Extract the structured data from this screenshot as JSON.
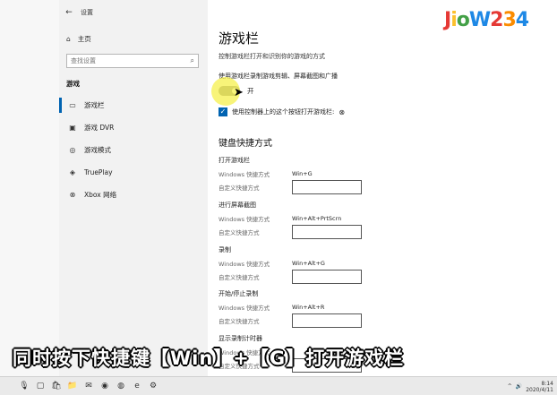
{
  "window": {
    "title": "设置",
    "back_icon": "back-arrow-icon"
  },
  "sidebar": {
    "home_label": "主页",
    "search_placeholder": "查找设置",
    "category": "游戏",
    "items": [
      {
        "label": "游戏栏",
        "icon": "game-bar-icon",
        "active": true
      },
      {
        "label": "游戏 DVR",
        "icon": "dvr-icon",
        "active": false
      },
      {
        "label": "游戏模式",
        "icon": "game-mode-icon",
        "active": false
      },
      {
        "label": "TruePlay",
        "icon": "trueplay-icon",
        "active": false
      },
      {
        "label": "Xbox 网络",
        "icon": "xbox-icon",
        "active": false
      }
    ]
  },
  "main": {
    "title": "游戏栏",
    "subtitle": "控制游戏栏打开和识别你的游戏的方式",
    "record_desc": "使用游戏栏录制游戏剪辑、屏幕截图和广播",
    "toggle_label": "开",
    "toggle_on": true,
    "checkbox_label": "使用控制器上的这个按钮打开游戏栏:",
    "checkbox_checked": true,
    "section_title": "键盘快捷方式",
    "shortcuts": [
      {
        "title": "打开游戏栏",
        "windows_label": "Windows 快捷方式",
        "windows_value": "Win+G",
        "custom_label": "自定义快捷方式",
        "custom_value": ""
      },
      {
        "title": "进行屏幕截图",
        "windows_label": "Windows 快捷方式",
        "windows_value": "Win+Alt+PrtScrn",
        "custom_label": "自定义快捷方式",
        "custom_value": ""
      },
      {
        "title": "录制",
        "windows_label": "Windows 快捷方式",
        "windows_value": "Win+Alt+G",
        "custom_label": "自定义快捷方式",
        "custom_value": ""
      },
      {
        "title": "开始/停止录制",
        "windows_label": "Windows 快捷方式",
        "windows_value": "Win+Alt+R",
        "custom_label": "自定义快捷方式",
        "custom_value": ""
      },
      {
        "title": "显示录制计时器",
        "windows_label": "Windows 快捷方式",
        "windows_value": "",
        "custom_label": "自定义快捷方式",
        "custom_value": ""
      }
    ]
  },
  "caption": "同时按下快捷键【Win】+【G】打开游戏栏",
  "logo": [
    "J",
    "i",
    "o",
    "W",
    "2",
    "3",
    "4"
  ],
  "taskbar": {
    "icons": [
      "microphone-icon",
      "task-view-icon",
      "store-icon",
      "folder-icon",
      "mail-icon",
      "chrome-icon",
      "browser-icon",
      "edge-icon",
      "settings-icon"
    ],
    "time": "8:14",
    "date": "2020/4/11"
  },
  "colors": {
    "accent": "#0063b1",
    "highlight": "#f5f04c"
  }
}
